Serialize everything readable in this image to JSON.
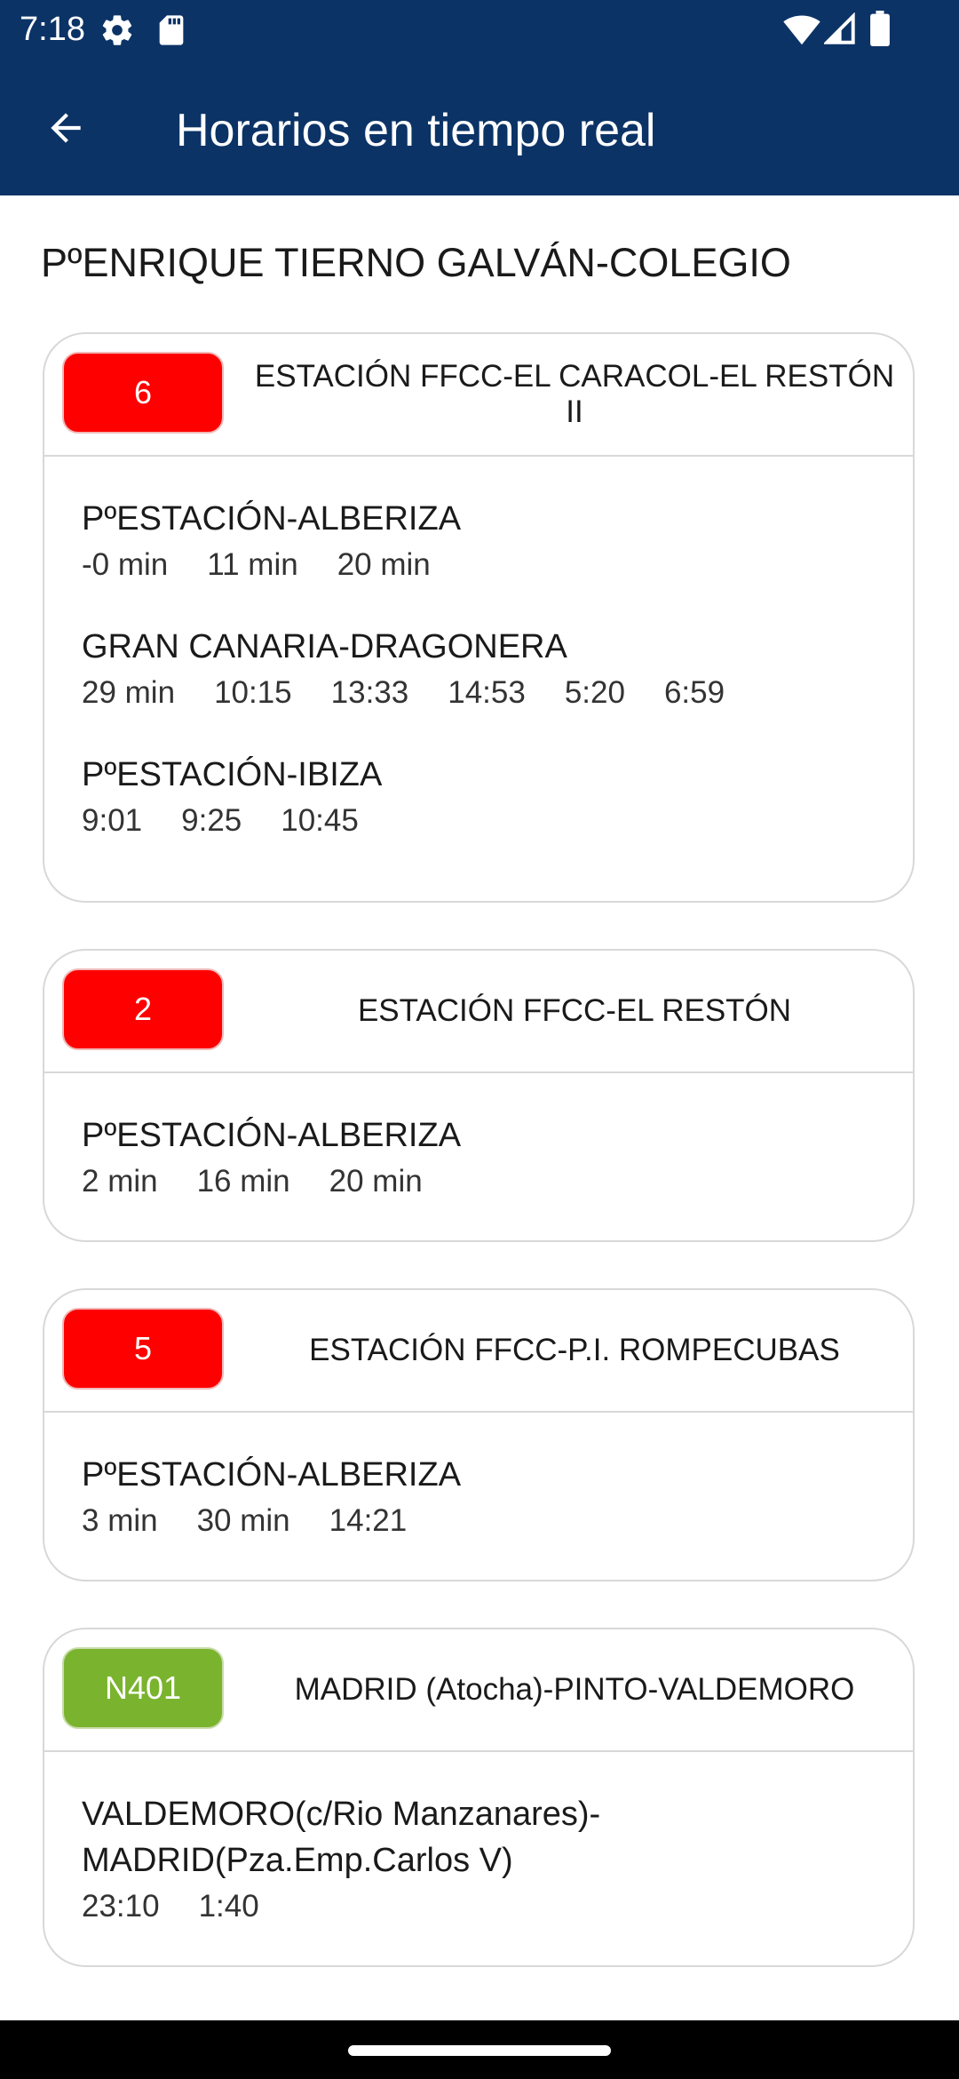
{
  "status": {
    "time": "7:18",
    "icons": [
      "settings-icon",
      "sd-card-icon",
      "wifi-icon",
      "signal-icon",
      "battery-icon"
    ]
  },
  "appbar": {
    "title": "Horarios en tiempo real",
    "back_icon": "arrow-left-icon",
    "bg_color": "#0b3366"
  },
  "stop": {
    "name": "PºENRIQUE TIERNO GALVÁN-COLEGIO"
  },
  "lines": [
    {
      "number": "6",
      "badge_color": "#ff0000",
      "destination": "ESTACIÓN FFCC-EL CARACOL-EL RESTÓN II",
      "directions": [
        {
          "name": "PºESTACIÓN-ALBERIZA",
          "times": [
            "-0 min",
            "11 min",
            "20 min"
          ]
        },
        {
          "name": "GRAN CANARIA-DRAGONERA",
          "times": [
            "29 min",
            "10:15",
            "13:33",
            "14:53",
            "5:20",
            "6:59"
          ]
        },
        {
          "name": "PºESTACIÓN-IBIZA",
          "times": [
            "9:01",
            "9:25",
            "10:45"
          ]
        }
      ]
    },
    {
      "number": "2",
      "badge_color": "#ff0000",
      "destination": "ESTACIÓN FFCC-EL RESTÓN",
      "directions": [
        {
          "name": "PºESTACIÓN-ALBERIZA",
          "times": [
            "2 min",
            "16 min",
            "20 min"
          ]
        }
      ]
    },
    {
      "number": "5",
      "badge_color": "#ff0000",
      "destination": "ESTACIÓN FFCC-P.I. ROMPECUBAS",
      "directions": [
        {
          "name": "PºESTACIÓN-ALBERIZA",
          "times": [
            "3 min",
            "30 min",
            "14:21"
          ]
        }
      ]
    },
    {
      "number": "N401",
      "badge_color": "#7ab32e",
      "destination": "MADRID (Atocha)-PINTO-VALDEMORO",
      "directions": [
        {
          "name": "VALDEMORO(c/Rio Manzanares)-MADRID(Pza.Emp.Carlos V)",
          "times": [
            "23:10",
            "1:40"
          ]
        }
      ]
    }
  ]
}
